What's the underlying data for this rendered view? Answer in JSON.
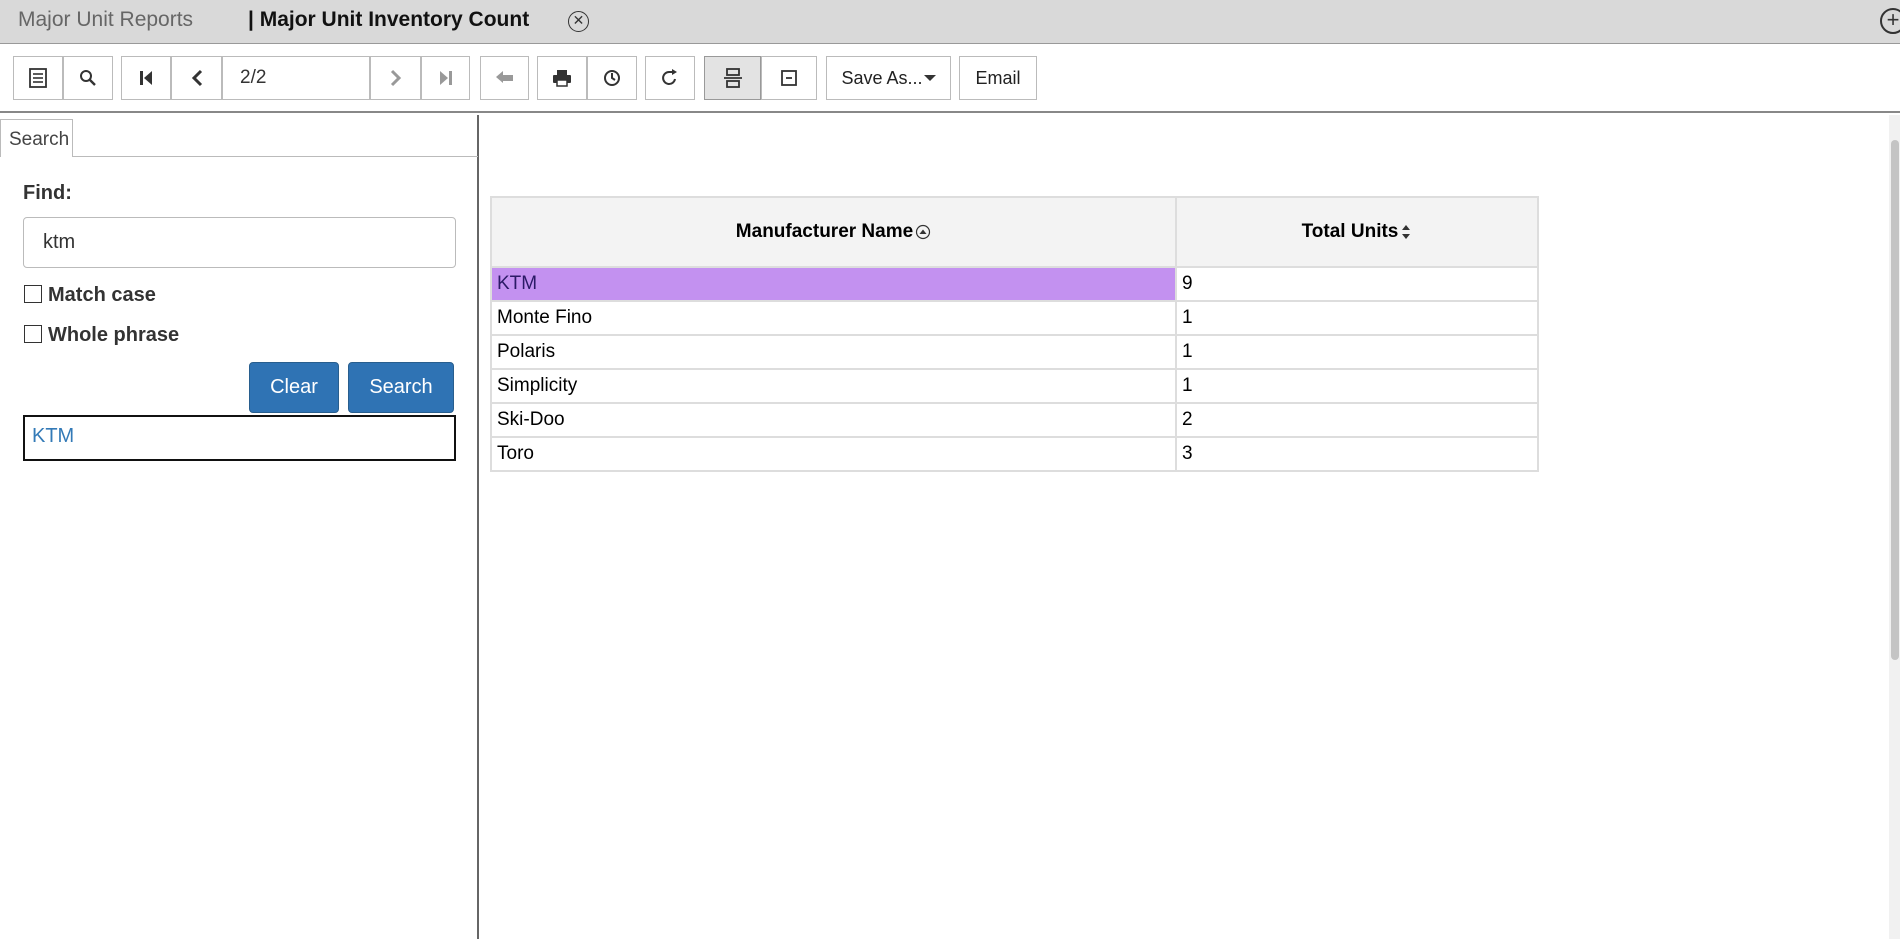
{
  "tabs": {
    "inactive_label": "Major Unit Reports",
    "active_label": "| Major Unit Inventory Count",
    "close_glyph": "⊗",
    "add_glyph": "+"
  },
  "toolbar": {
    "page_indicator": "2/2",
    "save_as_label": "Save As...",
    "email_label": "Email",
    "icons": [
      "toggle-sidebar-icon",
      "search-icon",
      "first-page-icon",
      "previous-page-icon",
      "next-page-icon",
      "last-page-icon",
      "back-icon",
      "print-icon",
      "history-icon",
      "refresh-icon",
      "page-layout-icon",
      "single-page-icon"
    ]
  },
  "search_panel": {
    "tab_label": "Search",
    "find_label": "Find:",
    "find_value": "ktm",
    "match_case_label": "Match case",
    "whole_phrase_label": "Whole phrase",
    "clear_label": "Clear",
    "search_label": "Search",
    "result": "KTM"
  },
  "report": {
    "columns": [
      "Manufacturer Name",
      "Total Units"
    ],
    "rows": [
      [
        "KTM",
        "9"
      ],
      [
        "Monte Fino",
        "1"
      ],
      [
        "Polaris",
        "1"
      ],
      [
        "Simplicity",
        "1"
      ],
      [
        "Ski-Doo",
        "2"
      ],
      [
        "Toro",
        "3"
      ]
    ],
    "highlighted_row": 0,
    "highlight_color": "#c391f0"
  },
  "colors": {
    "primary_button": "#2f73b4",
    "link": "#337ab7"
  }
}
